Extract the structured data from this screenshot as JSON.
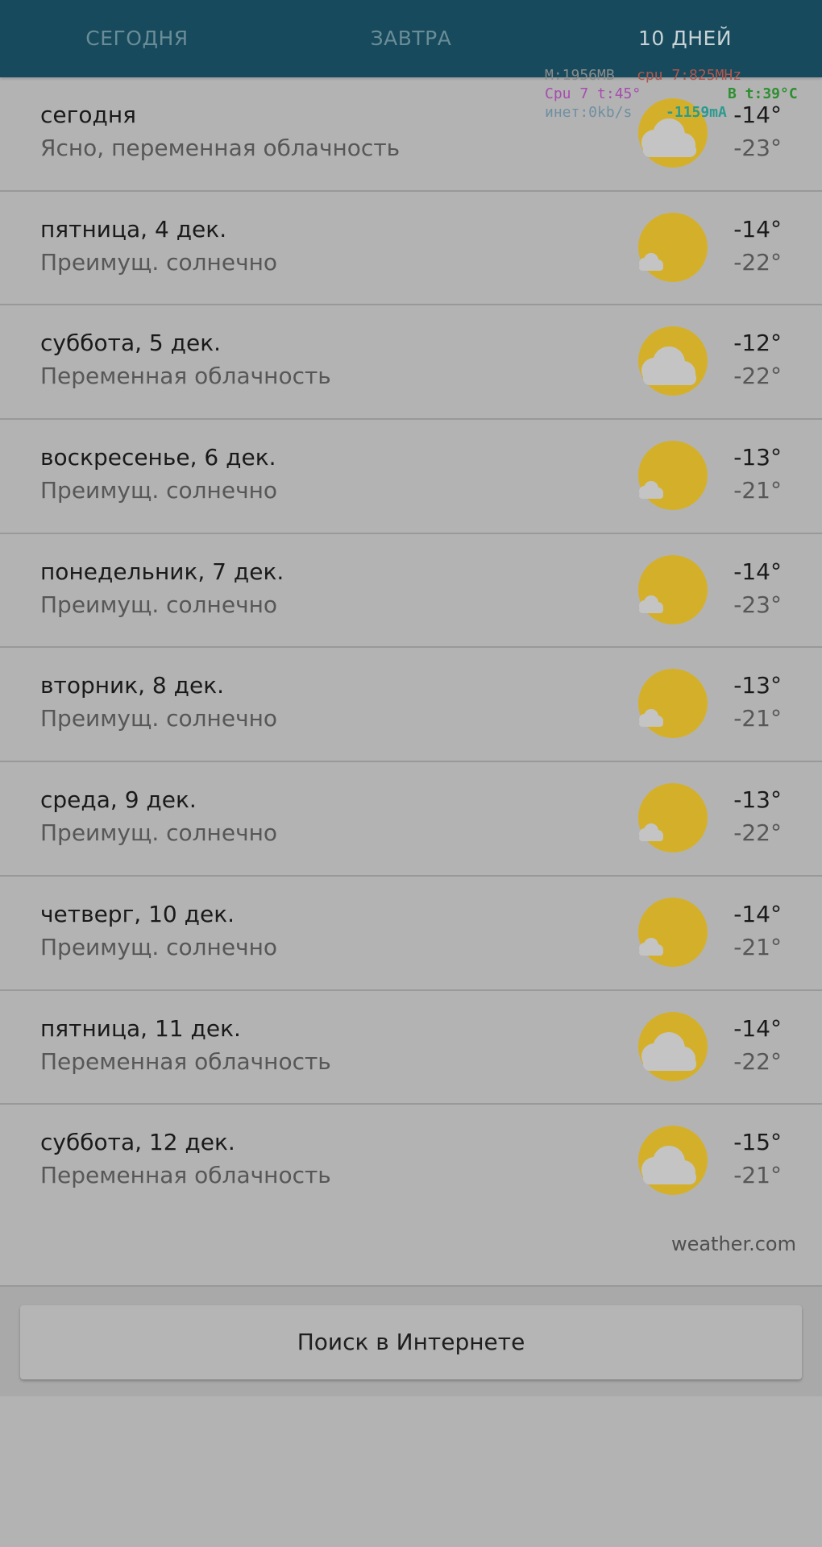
{
  "tabs": [
    {
      "label": "СЕГОДНЯ",
      "active": false
    },
    {
      "label": "ЗАВТРА",
      "active": false
    },
    {
      "label": "10 ДНЕЙ",
      "active": true
    }
  ],
  "overlay": {
    "memory": "M:1956MB",
    "cpu_freq": "cpu 7:825MHz",
    "cpu_temp": "Cpu 7 t:45°",
    "battery_temp": "B t:39°C",
    "net": "инет:0kb/s",
    "current": "-1159mA"
  },
  "forecast": [
    {
      "day": "сегодня",
      "description": "Ясно, переменная облачность",
      "high": "-14°",
      "low": "-23°",
      "icon": "partly-cloudy-icon"
    },
    {
      "day": "пятница, 4 дек.",
      "description": "Преимущ. солнечно",
      "high": "-14°",
      "low": "-22°",
      "icon": "mostly-sunny-icon"
    },
    {
      "day": "суббота, 5 дек.",
      "description": "Переменная облачность",
      "high": "-12°",
      "low": "-22°",
      "icon": "partly-cloudy-icon"
    },
    {
      "day": "воскресенье, 6 дек.",
      "description": "Преимущ. солнечно",
      "high": "-13°",
      "low": "-21°",
      "icon": "mostly-sunny-icon"
    },
    {
      "day": "понедельник, 7 дек.",
      "description": "Преимущ. солнечно",
      "high": "-14°",
      "low": "-23°",
      "icon": "mostly-sunny-icon"
    },
    {
      "day": "вторник, 8 дек.",
      "description": "Преимущ. солнечно",
      "high": "-13°",
      "low": "-21°",
      "icon": "mostly-sunny-icon"
    },
    {
      "day": "среда, 9 дек.",
      "description": "Преимущ. солнечно",
      "high": "-13°",
      "low": "-22°",
      "icon": "mostly-sunny-icon"
    },
    {
      "day": "четверг, 10 дек.",
      "description": "Преимущ. солнечно",
      "high": "-14°",
      "low": "-21°",
      "icon": "mostly-sunny-icon"
    },
    {
      "day": "пятница, 11 дек.",
      "description": "Переменная облачность",
      "high": "-14°",
      "low": "-22°",
      "icon": "partly-cloudy-icon"
    },
    {
      "day": "суббота, 12 дек.",
      "description": "Переменная облачность",
      "high": "-15°",
      "low": "-21°",
      "icon": "partly-cloudy-icon"
    }
  ],
  "source": "weather.com",
  "search_button": "Поиск в Интернете",
  "colors": {
    "tabbar": "#164a5c",
    "sun": "#d4b02a",
    "cloud": "#c4c4c4",
    "background": "#b3b3b3"
  }
}
